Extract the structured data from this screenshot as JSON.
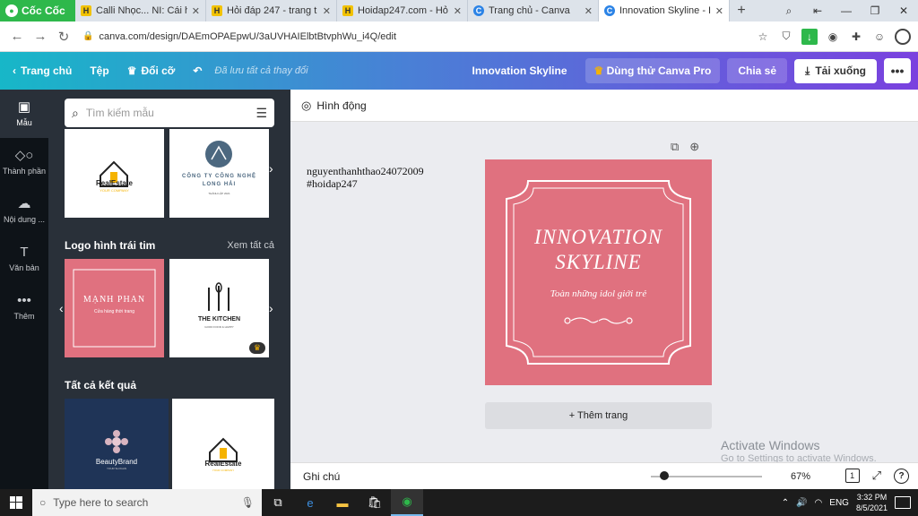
{
  "browser": {
    "brand": "Cốc Cốc",
    "tabs": [
      {
        "label": "Calli Nhọc... NI: Cái h",
        "icon": "hoidap-icon",
        "active": false
      },
      {
        "label": "Hỏi đáp 247 - trang t",
        "icon": "hoidap-icon",
        "active": false
      },
      {
        "label": "Hoidap247.com - Hỏ",
        "icon": "hoidap-icon",
        "active": false
      },
      {
        "label": "Trang chủ - Canva",
        "icon": "canva-icon",
        "active": false
      },
      {
        "label": "Innovation Skyline - I",
        "icon": "canva-icon",
        "active": true
      }
    ],
    "url": "canva.com/design/DAEmOPAEpwU/3aUVHAIElbtBtvphWu_i4Q/edit"
  },
  "topbar": {
    "home": "Trang chủ",
    "file": "Tệp",
    "resize": "Đổi cỡ",
    "saved": "Đã lưu tất cả thay đổi",
    "doc_title": "Innovation Skyline",
    "try_pro": "Dùng thử Canva Pro",
    "share": "Chia sẻ",
    "download": "Tải xuống"
  },
  "rail": [
    {
      "label": "Mẫu",
      "icon": "template-icon",
      "active": true
    },
    {
      "label": "Thành phần",
      "icon": "elements-icon",
      "active": false
    },
    {
      "label": "Nội dung ...",
      "icon": "upload-icon",
      "active": false
    },
    {
      "label": "Văn bản",
      "icon": "text-icon",
      "active": false
    },
    {
      "label": "Thêm",
      "icon": "more-icon",
      "active": false
    }
  ],
  "panel": {
    "search_placeholder": "Tìm kiếm mẫu",
    "row1": [
      {
        "name": "RealEstate",
        "sub": "YOUR COMPANY"
      },
      {
        "name": "CÔNG TY CÔNG NGHỆ",
        "name2": "LONG HẢI",
        "sub": "THÀNH LẬP 2021"
      }
    ],
    "section_hearts": {
      "title": "Logo hình trái tim",
      "see_all": "Xem tất cả"
    },
    "row2": [
      {
        "name": "MẠNH PHAN",
        "sub": "Cửa hàng thời trang"
      },
      {
        "name": "THE KITCHEN",
        "sub": "GOOD FOOD & HAPPY"
      }
    ],
    "section_all": {
      "title": "Tất cả kết quả"
    },
    "row3": [
      {
        "name": "BeautyBrand",
        "sub": "YOUR SLOGAN"
      },
      {
        "name": "RealEstate",
        "sub": "YOUR COMPANY"
      }
    ]
  },
  "editor": {
    "animate": "Hình động",
    "note_line1": "nguyenthanhthao24072009",
    "note_line2": "#hoidap247",
    "design": {
      "line1": "INNOVATION",
      "line2": "SKYLINE",
      "tagline": "Toàn những idol giới trẻ",
      "bg_color": "#e0717f"
    },
    "add_page": "+ Thêm trang",
    "notes": "Ghi chú",
    "zoom": "67%",
    "zoom_fraction": 0.08,
    "page_count": "1"
  },
  "watermark": {
    "title": "Activate Windows",
    "sub": "Go to Settings to activate Windows."
  },
  "taskbar": {
    "search_placeholder": "Type here to search",
    "lang": "ENG",
    "time": "3:32 PM",
    "date": "8/5/2021"
  }
}
